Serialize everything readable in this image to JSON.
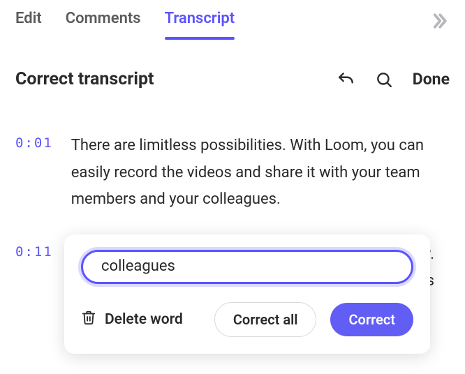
{
  "tabs": {
    "edit": "Edit",
    "comments": "Comments",
    "transcript": "Transcript"
  },
  "toolbar": {
    "title": "Correct transcript",
    "done": "Done"
  },
  "segments": [
    {
      "time": "0:01",
      "text": "There are limitless possibilities. With Loom, you can easily record the videos and share it with your team members and your colleagues."
    },
    {
      "time": "0:11",
      "text_behind_line1": "sy.",
      "text_behind_line2": "ws"
    }
  ],
  "popover": {
    "input_value": "colleagues",
    "delete_label": "Delete word",
    "correct_all": "Correct all",
    "correct": "Correct"
  }
}
